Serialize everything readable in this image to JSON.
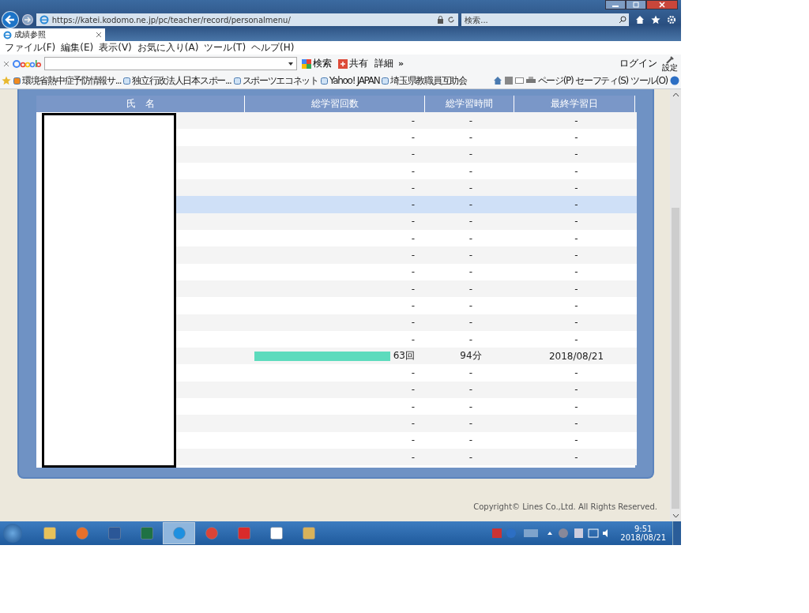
{
  "browser": {
    "url": "https://katei.kodomo.ne.jp/pc/teacher/record/personalmenu/",
    "search_placeholder": "検索...",
    "tab": {
      "title": "成績参照"
    },
    "menu": [
      "ファイル(F)",
      "編集(E)",
      "表示(V)",
      "お気に入り(A)",
      "ツール(T)",
      "ヘルプ(H)"
    ],
    "google_toolbar": {
      "search_button": "検索",
      "share": "共有",
      "details": "詳細",
      "more": "»",
      "login": "ログイン",
      "settings": "設定"
    },
    "favorites": [
      "環境省熱中症予防情報サ...",
      "独立行政法人日本スポー...",
      "スポーツエコネット",
      "Yahoo! JAPAN",
      "埼玉県教職員互助会"
    ],
    "command_bar": [
      "ページ(P)",
      "セーフティ(S)",
      "ツール(O)"
    ]
  },
  "table": {
    "columns": [
      "氏　名",
      "総学習回数",
      "総学習時間",
      "最終学習日"
    ],
    "rows": [
      {
        "count": "-",
        "time": "-",
        "date": "-",
        "selected": false
      },
      {
        "count": "-",
        "time": "-",
        "date": "-",
        "selected": false
      },
      {
        "count": "-",
        "time": "-",
        "date": "-",
        "selected": false
      },
      {
        "count": "-",
        "time": "-",
        "date": "-",
        "selected": false
      },
      {
        "count": "-",
        "time": "-",
        "date": "-",
        "selected": false
      },
      {
        "count": "-",
        "time": "-",
        "date": "-",
        "selected": true
      },
      {
        "count": "-",
        "time": "-",
        "date": "-",
        "selected": false
      },
      {
        "count": "-",
        "time": "-",
        "date": "-",
        "selected": false
      },
      {
        "count": "-",
        "time": "-",
        "date": "-",
        "selected": false
      },
      {
        "count": "-",
        "time": "-",
        "date": "-",
        "selected": false
      },
      {
        "count": "-",
        "time": "-",
        "date": "-",
        "selected": false
      },
      {
        "count": "-",
        "time": "-",
        "date": "-",
        "selected": false
      },
      {
        "count": "-",
        "time": "-",
        "date": "-",
        "selected": false
      },
      {
        "count": "-",
        "time": "-",
        "date": "-",
        "selected": false
      },
      {
        "count": "63回",
        "time": "94分",
        "date": "2018/08/21",
        "selected": false,
        "level": 1
      },
      {
        "count": "-",
        "time": "-",
        "date": "-",
        "selected": false
      },
      {
        "count": "-",
        "time": "-",
        "date": "-",
        "selected": false
      },
      {
        "count": "-",
        "time": "-",
        "date": "-",
        "selected": false
      },
      {
        "count": "-",
        "time": "-",
        "date": "-",
        "selected": false
      },
      {
        "count": "-",
        "time": "-",
        "date": "-",
        "selected": false
      },
      {
        "count": "-",
        "time": "-",
        "date": "-",
        "selected": false
      }
    ]
  },
  "copyright": "Copyright© Lines Co.,Ltd. All Rights Reserved.",
  "taskbar": {
    "apps": [
      {
        "kind": "folder",
        "selected": false
      },
      {
        "kind": "media",
        "selected": false
      },
      {
        "kind": "word",
        "selected": false
      },
      {
        "kind": "excel",
        "selected": false
      },
      {
        "kind": "ie",
        "selected": true
      },
      {
        "kind": "chrome",
        "selected": false
      },
      {
        "kind": "red",
        "selected": false
      },
      {
        "kind": "document",
        "selected": false
      },
      {
        "kind": "mail",
        "selected": false
      }
    ],
    "time": "9:51",
    "date": "2018/08/21"
  }
}
